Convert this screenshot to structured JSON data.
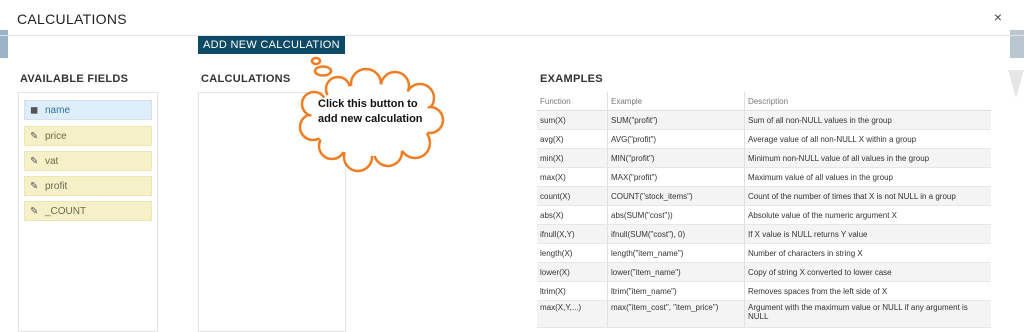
{
  "modal": {
    "title": "CALCULATIONS",
    "close_glyph": "×"
  },
  "toolbar": {
    "add_label": "ADD NEW CALCULATION"
  },
  "callout": {
    "text": "Click this button to add new calculation"
  },
  "sections": {
    "fields": "AVAILABLE FIELDS",
    "calculations": "CALCULATIONS",
    "examples": "EXAMPLES"
  },
  "fields": [
    {
      "label": "name",
      "type": "dimension",
      "icon": "cube-icon"
    },
    {
      "label": "price",
      "type": "measure",
      "icon": "pencil-icon"
    },
    {
      "label": "vat",
      "type": "measure",
      "icon": "pencil-icon"
    },
    {
      "label": "profit",
      "type": "measure",
      "icon": "pencil-icon"
    },
    {
      "label": "_COUNT",
      "type": "measure",
      "icon": "pencil-icon"
    }
  ],
  "examples": {
    "headers": {
      "function": "Function",
      "example": "Example",
      "description": "Description"
    },
    "rows": [
      {
        "function": "sum(X)",
        "example": "SUM(\"profit\")",
        "description": "Sum of all non-NULL values in the group"
      },
      {
        "function": "avg(X)",
        "example": "AVG(\"profit\")",
        "description": "Average value of all non-NULL X within a group"
      },
      {
        "function": "min(X)",
        "example": "MIN(\"profit\")",
        "description": "Minimum non-NULL value of all values in the group"
      },
      {
        "function": "max(X)",
        "example": "MAX(\"profit\")",
        "description": "Maximum value of all values in the group"
      },
      {
        "function": "count(X)",
        "example": "COUNT(\"stock_items\")",
        "description": "Count of the number of times that X is not NULL in a group"
      },
      {
        "function": "abs(X)",
        "example": "abs(SUM(\"cost\"))",
        "description": "Absolute value of the numeric argument X"
      },
      {
        "function": "ifnull(X,Y)",
        "example": "ifnull(SUM(\"cost\"), 0)",
        "description": "If X value is NULL returns Y value"
      },
      {
        "function": "length(X)",
        "example": "length(\"item_name\")",
        "description": "Number of characters in string X"
      },
      {
        "function": "lower(X)",
        "example": "lower(\"item_name\")",
        "description": "Copy of string X converted to lower case"
      },
      {
        "function": "ltrim(X)",
        "example": "ltrim(\"item_name\")",
        "description": "Removes spaces from the left side of X"
      },
      {
        "function": "max(X,Y,...)",
        "example": "max(\"item_cost\", \"item_price\")",
        "description": "Argument with the maximum value or NULL if any argument is NULL"
      }
    ]
  },
  "colors": {
    "button": "#0d4a66",
    "callout_outline": "#f07d22",
    "dimension_bg": "#ddeefa",
    "measure_bg": "#f6f0c8"
  }
}
